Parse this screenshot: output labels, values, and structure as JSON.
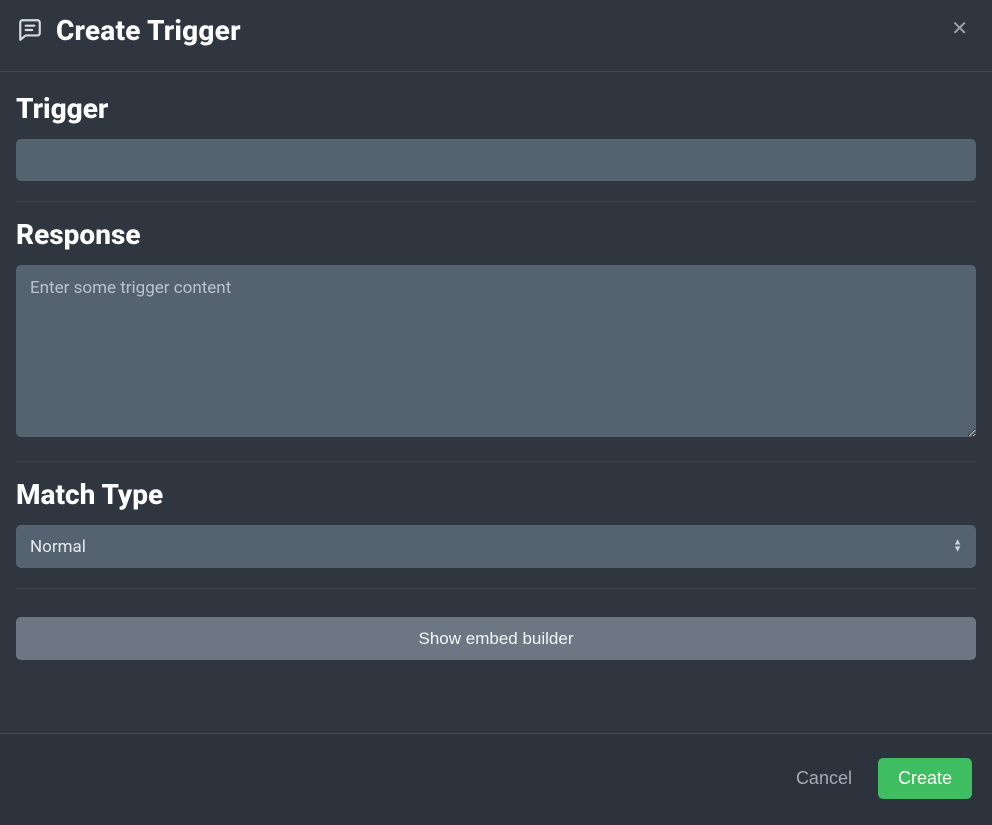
{
  "header": {
    "title": "Create Trigger"
  },
  "sections": {
    "trigger": {
      "label": "Trigger",
      "value": ""
    },
    "response": {
      "label": "Response",
      "placeholder": "Enter some trigger content",
      "value": ""
    },
    "match_type": {
      "label": "Match Type",
      "selected": "Normal"
    },
    "embed_builder": {
      "label": "Show embed builder"
    }
  },
  "footer": {
    "cancel": "Cancel",
    "create": "Create"
  }
}
